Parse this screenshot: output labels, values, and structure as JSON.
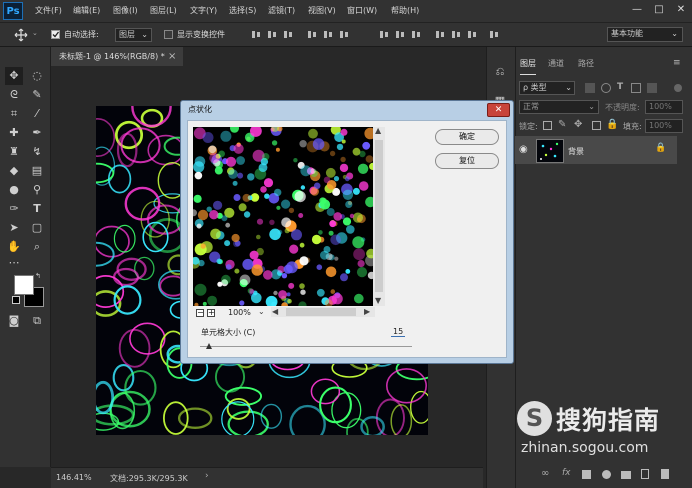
{
  "app": {
    "logo": "Ps"
  },
  "menu": [
    "文件(F)",
    "编辑(E)",
    "图像(I)",
    "图层(L)",
    "文字(Y)",
    "选择(S)",
    "滤镜(T)",
    "视图(V)",
    "窗口(W)",
    "帮助(H)"
  ],
  "window_controls": {
    "minimize": "—",
    "maximize": "□",
    "close": "✕"
  },
  "options": {
    "auto_select_label": "自动选择:",
    "auto_select_value": "图层",
    "show_transform_label": "显示变换控件",
    "workspace": "基本功能"
  },
  "document": {
    "tab_title": "未标题-1 @ 146%(RGB/8) *",
    "tab_close": "×"
  },
  "status": {
    "zoom": "146.41%",
    "doc_info": "文档:295.3K/295.3K"
  },
  "layers_panel": {
    "tabs": [
      "图层",
      "通道",
      "路径"
    ],
    "filter_placeholder": "ρ 类型",
    "blend_mode": "正常",
    "opacity_label": "不透明度:",
    "opacity_value": "100%",
    "lock_label": "锁定:",
    "fill_label": "填充:",
    "fill_value": "100%",
    "layer_name": "背景"
  },
  "dialog": {
    "title": "点状化",
    "close": "✕",
    "ok": "确定",
    "reset": "复位",
    "zoom": "100%",
    "cell_size_label": "单元格大小 (C)",
    "cell_size_value": "15",
    "zoom_out": "−",
    "zoom_in": "+"
  },
  "watermark": {
    "logo": "S",
    "text": "搜狗指南",
    "url": "zhinan.sogou.com"
  },
  "colors": {
    "ui_dark": "#323232",
    "canvas_bg": "#02030a",
    "dialog_frame": "#b8cfe5",
    "close_red": "#c8443a",
    "cell_palette": [
      "#38e8ff",
      "#3bff6a",
      "#c6ff3a",
      "#ff3ad6",
      "#ffffff",
      "#ff9a2e",
      "#6a5bff"
    ]
  }
}
